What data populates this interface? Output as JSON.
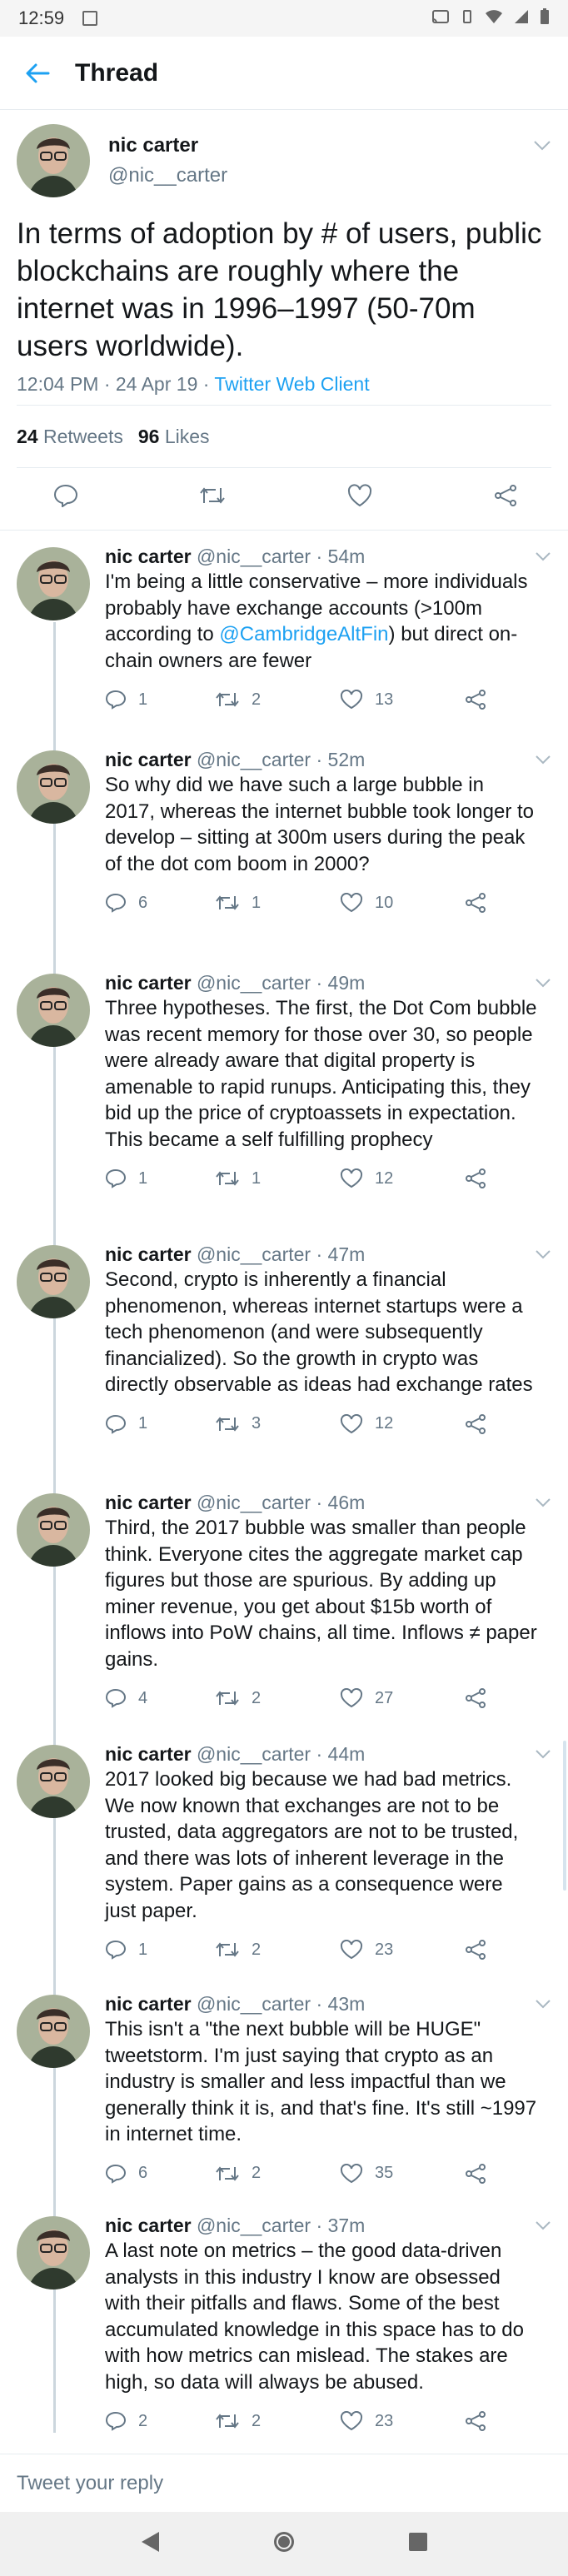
{
  "status_bar": {
    "time": "12:59"
  },
  "header": {
    "title": "Thread"
  },
  "main_tweet": {
    "name": "nic carter",
    "handle": "@nic__carter",
    "text": "In terms of adoption by # of users, public blockchains are roughly where the internet was in 1996–1997 (50-70m users worldwide).",
    "timestamp": "12:04 PM · 24 Apr 19 · ",
    "client": "Twitter Web Client",
    "retweets_count": "24",
    "retweets_label": "Retweets",
    "likes_count": "96",
    "likes_label": "Likes"
  },
  "replies": [
    {
      "name": "nic carter",
      "handle": "@nic__carter",
      "time": "54m",
      "text_before": "I'm being a little conservative – more individuals probably have exchange accounts (>100m according to ",
      "mention": "@CambridgeAltFin",
      "text_after": ") but direct on-chain owners are fewer",
      "replies": "1",
      "retweets": "2",
      "likes": "13"
    },
    {
      "name": "nic carter",
      "handle": "@nic__carter",
      "time": "52m",
      "text": "So why did we have such a large bubble in 2017, whereas the internet bubble took longer to develop – sitting at 300m users during the peak of the dot com boom in 2000?",
      "replies": "6",
      "retweets": "1",
      "likes": "10"
    },
    {
      "name": "nic carter",
      "handle": "@nic__carter",
      "time": "49m",
      "text": "Three hypotheses. The first, the Dot Com bubble was recent memory for those over 30, so people were already aware that digital property is amenable to rapid runups. Anticipating this, they bid up the price of cryptoassets in expectation. This became a self fulfilling prophecy",
      "replies": "1",
      "retweets": "1",
      "likes": "12"
    },
    {
      "name": "nic carter",
      "handle": "@nic__carter",
      "time": "47m",
      "text": "Second, crypto is inherently a financial phenomenon, whereas internet startups were a tech phenomenon (and were subsequently financialized). So the growth in crypto was directly observable as ideas had exchange rates",
      "replies": "1",
      "retweets": "3",
      "likes": "12"
    },
    {
      "name": "nic carter",
      "handle": "@nic__carter",
      "time": "46m",
      "text": "Third, the 2017 bubble was smaller than people think. Everyone cites the aggregate market cap figures but those are spurious. By adding up miner revenue, you get about $15b worth of inflows into PoW chains, all time. Inflows ≠ paper gains.",
      "replies": "4",
      "retweets": "2",
      "likes": "27"
    },
    {
      "name": "nic carter",
      "handle": "@nic__carter",
      "time": "44m",
      "text": "2017 looked big because we had bad metrics. We now known that exchanges are not to be trusted, data aggregators are not to be trusted, and there was lots of inherent leverage in the system. Paper gains as a consequence were just paper.",
      "replies": "1",
      "retweets": "2",
      "likes": "23"
    },
    {
      "name": "nic carter",
      "handle": "@nic__carter",
      "time": "43m",
      "text": "This isn't a \"the next bubble will be HUGE\" tweetstorm. I'm just saying that crypto as an industry is smaller and less impactful than we generally think it is, and that's fine. It's still ~1997 in internet time.",
      "replies": "6",
      "retweets": "2",
      "likes": "35"
    },
    {
      "name": "nic carter",
      "handle": "@nic__carter",
      "time": "37m",
      "text": "A last note on metrics – the good data-driven analysts in this industry I know are obsessed with their pitfalls and flaws. Some of the best accumulated knowledge in this space has to do with how metrics can mislead. The stakes are high, so data will always be abused.",
      "replies": "2",
      "retweets": "2",
      "likes": "23"
    }
  ],
  "composer": {
    "placeholder": "Tweet your reply"
  },
  "colors": {
    "accent": "#1da1f2",
    "text": "#14171a",
    "muted": "#657786",
    "divider": "#e6ecf0"
  },
  "icons": [
    "back-arrow-icon",
    "reply-icon",
    "retweet-icon",
    "like-icon",
    "share-icon",
    "chevron-down-icon",
    "nav-back-icon",
    "nav-home-icon",
    "nav-recents-icon"
  ]
}
